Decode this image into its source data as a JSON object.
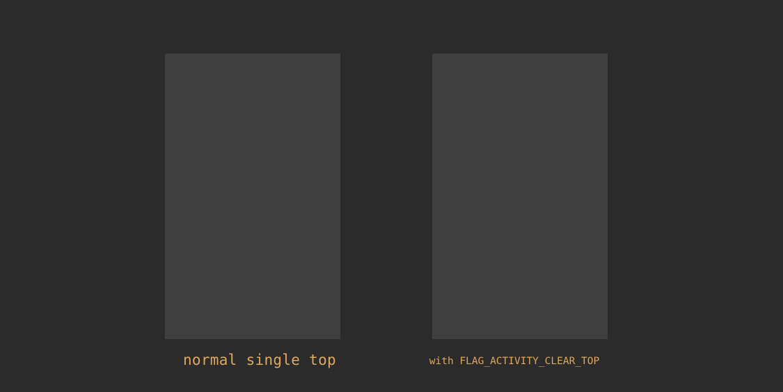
{
  "panels": {
    "left": {
      "caption": "normal single top"
    },
    "right": {
      "caption": "with FLAG_ACTIVITY_CLEAR_TOP"
    }
  },
  "colors": {
    "background": "#2b2b2b",
    "panel": "#404040",
    "caption": "#e0a85c"
  }
}
